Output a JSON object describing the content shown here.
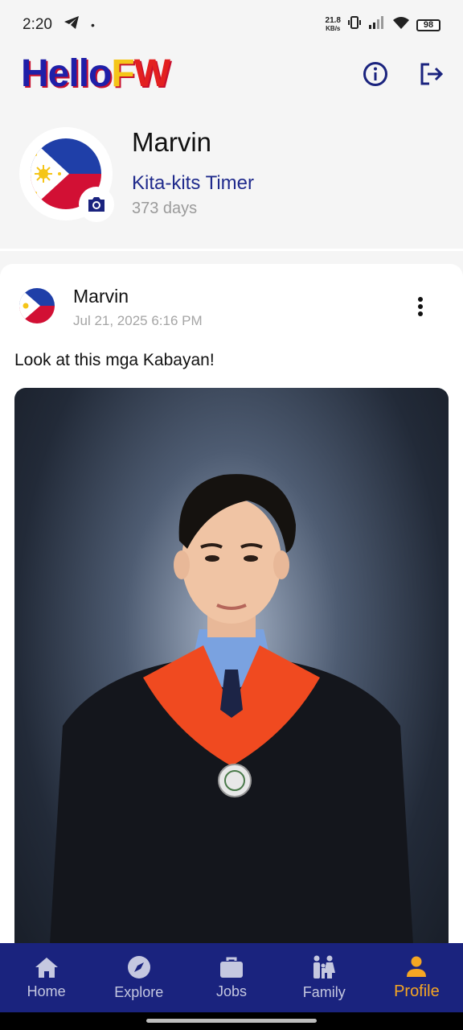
{
  "status_bar": {
    "time": "2:20",
    "net_speed_top": "21.8",
    "net_speed_bottom": "KB/s",
    "battery": "98"
  },
  "header": {
    "logo_hello": "Hello",
    "logo_f": "F",
    "logo_w": "W",
    "info_icon": "info-icon",
    "logout_icon": "logout-icon"
  },
  "profile": {
    "name": "Marvin",
    "subtitle": "Kita-kits Timer",
    "days": "373 days"
  },
  "post": {
    "author": "Marvin",
    "date": "Jul 21, 2025 6:16 PM",
    "text": "Look at this mga Kabayan!"
  },
  "nav": {
    "items": [
      {
        "label": "Home",
        "icon": "home-icon"
      },
      {
        "label": "Explore",
        "icon": "compass-icon"
      },
      {
        "label": "Jobs",
        "icon": "briefcase-icon"
      },
      {
        "label": "Family",
        "icon": "family-icon"
      },
      {
        "label": "Profile",
        "icon": "person-icon"
      }
    ],
    "active_index": 4
  },
  "colors": {
    "brand_blue": "#1a237e",
    "active_orange": "#f5a623",
    "subtitle_blue": "#1f2a8c"
  }
}
